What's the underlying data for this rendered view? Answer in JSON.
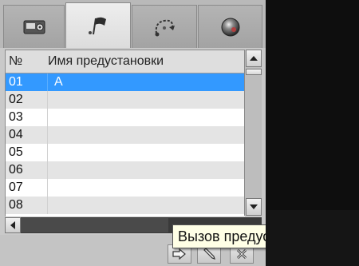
{
  "tabs": [
    {
      "icon": "camera-settings-icon",
      "active": false
    },
    {
      "icon": "preset-flag-icon",
      "active": true
    },
    {
      "icon": "tour-route-icon",
      "active": false
    },
    {
      "icon": "color-ball-icon",
      "active": false
    }
  ],
  "list": {
    "header_num": "№",
    "header_name": "Имя предустановки",
    "rows": [
      {
        "num": "01",
        "name": "A",
        "selected": true
      },
      {
        "num": "02",
        "name": ""
      },
      {
        "num": "03",
        "name": ""
      },
      {
        "num": "04",
        "name": ""
      },
      {
        "num": "05",
        "name": ""
      },
      {
        "num": "06",
        "name": ""
      },
      {
        "num": "07",
        "name": ""
      },
      {
        "num": "08",
        "name": ""
      }
    ]
  },
  "toolbar": {
    "call_icon": "arrow-right-icon",
    "edit_icon": "pencil-icon",
    "delete_icon": "delete-x-icon"
  },
  "tooltip": {
    "text": "Вызов предустановки"
  },
  "colors": {
    "selection": "#3399ff",
    "panel": "#c9c9c9",
    "video_background": "#0e0e0e"
  }
}
